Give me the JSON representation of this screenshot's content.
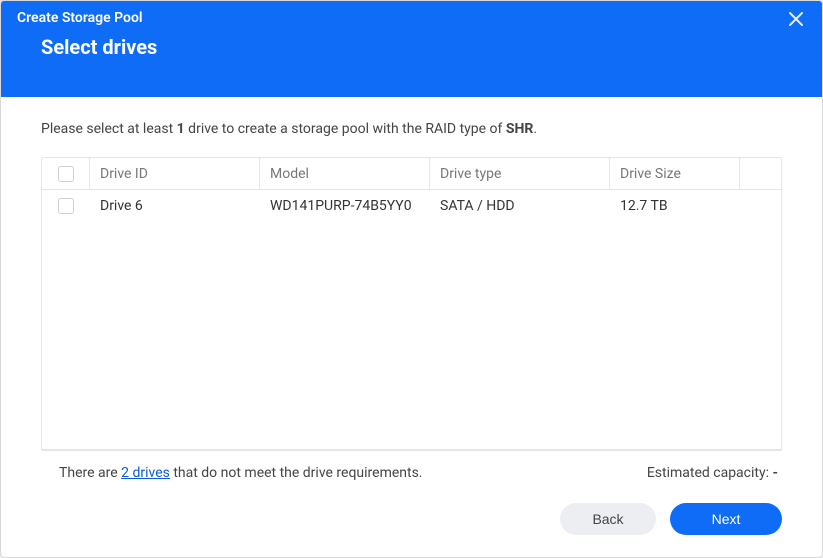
{
  "window_title": "Create Storage Pool",
  "step_title": "Select drives",
  "prompt": {
    "pre": "Please select at least ",
    "count": "1",
    "mid": " drive to create a storage pool with the RAID type of ",
    "raid": "SHR",
    "post": "."
  },
  "columns": {
    "drive_id": "Drive ID",
    "model": "Model",
    "drive_type": "Drive type",
    "drive_size": "Drive Size"
  },
  "rows": [
    {
      "drive_id": "Drive 6",
      "model": "WD141PURP-74B5YY0",
      "drive_type": "SATA / HDD",
      "drive_size": "12.7 TB"
    }
  ],
  "non_meeting": {
    "pre": "There are ",
    "link": "2 drives",
    "post": " that do not meet the drive requirements."
  },
  "estimated_capacity": {
    "label": "Estimated capacity: ",
    "value": "-"
  },
  "buttons": {
    "back": "Back",
    "next": "Next"
  }
}
